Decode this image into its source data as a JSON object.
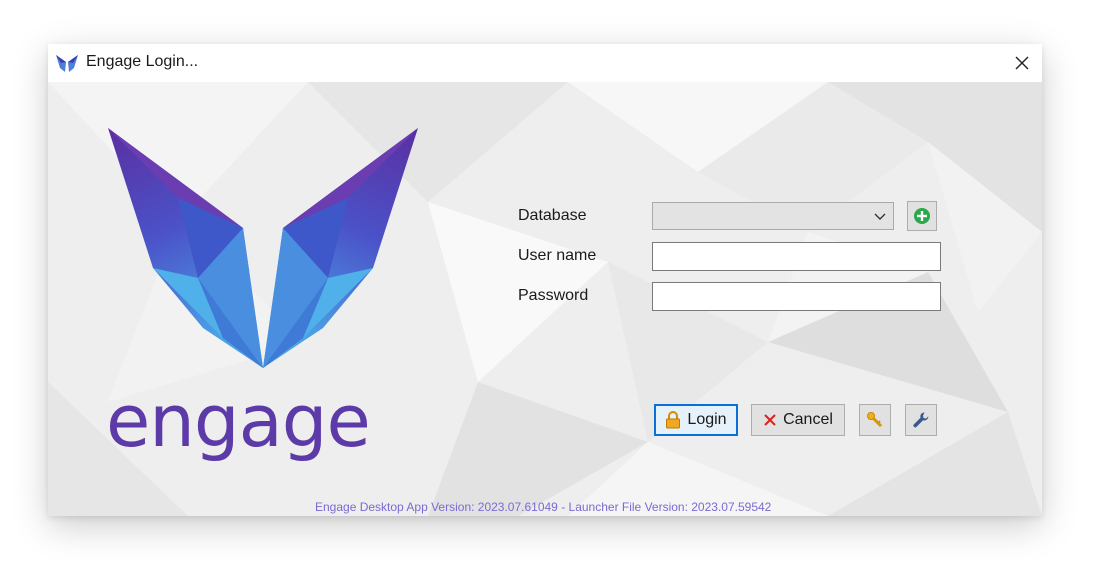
{
  "window": {
    "title": "Engage Login...",
    "app_icon": "butterfly-icon",
    "close_icon": "close-icon"
  },
  "branding": {
    "wordmark": "engage",
    "accent_color": "#5c3aa8",
    "logo_gradient_top": "#5a2fa0",
    "logo_gradient_bottom": "#4aa3e6"
  },
  "form": {
    "database_label": "Database",
    "database_value": "",
    "username_label": "User name",
    "username_value": "",
    "password_label": "Password",
    "password_value": "",
    "add_database_icon": "plus-circle-icon"
  },
  "buttons": {
    "login_label": "Login",
    "login_icon": "lock-icon",
    "cancel_label": "Cancel",
    "cancel_icon": "x-icon",
    "key_icon": "key-icon",
    "settings_icon": "wrench-icon"
  },
  "footer": {
    "version_text": "Engage Desktop App Version: 2023.07.61049 - Launcher File Version: 2023.07.59542",
    "version_color": "#7b6ad1"
  }
}
